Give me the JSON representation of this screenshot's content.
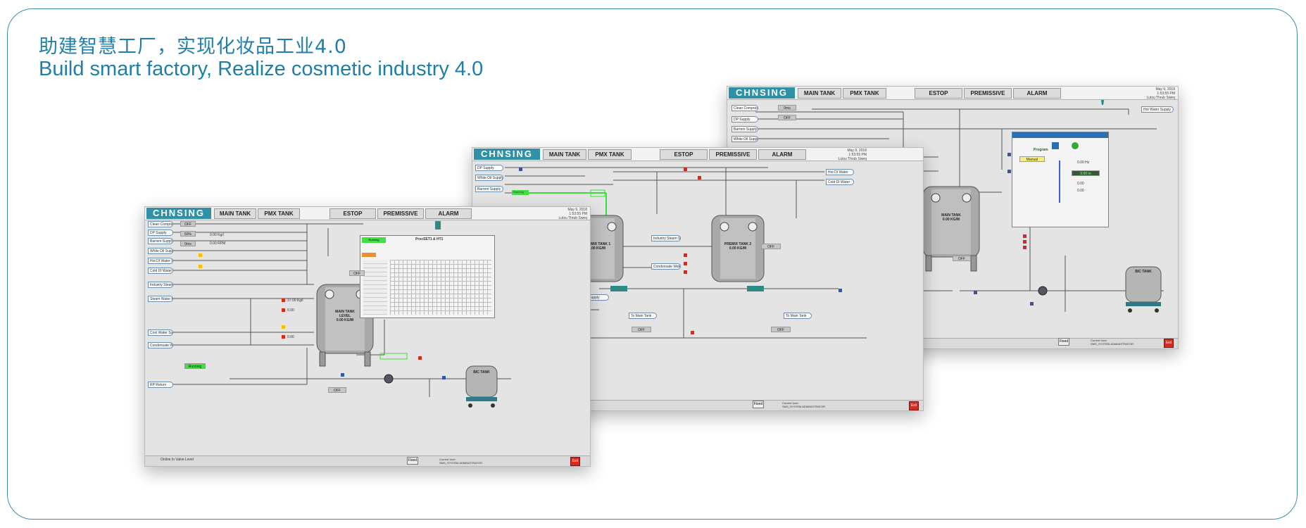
{
  "header": {
    "title_cn": "助建智慧工厂，实现化妆品工业4.0",
    "title_en": "Build smart factory, Realize cosmetic industry 4.0"
  },
  "colors": {
    "accent": "#1f7fa8",
    "logo": "#2f90a6",
    "running": "#44dd44",
    "alarm": "#d62a1e"
  },
  "hmi": {
    "logo": "CHNSING",
    "tabs": [
      "MAIN TANK",
      "PMX TANK",
      "ESTOP",
      "PREMISSIVE",
      "ALARM"
    ],
    "date": [
      "May 9, 2018",
      "1:53:55 PM",
      "Lutzu  Thrub  Sweq"
    ],
    "exit": "Exit",
    "fixed": "Fixed",
    "user": [
      "Current User",
      "SMS_SYSTEM ADMINISTRATOR"
    ]
  },
  "screen1": {
    "supplies": [
      "Clean Compressed Air",
      "DP Supply",
      "Barrem Supply",
      "White Oil Supply",
      "Hot DI Water Supply",
      "Cold DI Water Supply"
    ],
    "supplies2": [
      "Industry Steam Supply",
      "Steam Water Return",
      "Cool Water Supply",
      "Condensate Water Return",
      "RP Return"
    ],
    "tank_main": [
      "MAIN TANK",
      "LEVEL",
      "0.00 KG/M"
    ],
    "tank_bic": "BIC TANK",
    "recipe_title": "ProcSET1 & HT1",
    "recipe_status": "Running",
    "pump_status": "Running",
    "values": [
      "0.00 Kg/l",
      "0.00 RPM",
      "0.00",
      "37.00 Kg/l",
      "0.00",
      "0.00"
    ],
    "vbox": [
      "OFF",
      "50%",
      "0ms",
      "OFF",
      "OFF"
    ],
    "footer": "Online  In  Valve Level"
  },
  "screen2": {
    "supplies": [
      "DP Supply",
      "White Oil Supply",
      "Barrem Supply"
    ],
    "right_supplies": [
      "Hot DI Water",
      "Cold DI Water"
    ],
    "tank1": [
      "PREMIX TANK 1",
      "0.00 KG/M"
    ],
    "tank2": [
      "PREMIX TANK 2",
      "0.00 KG/M"
    ],
    "mid": [
      "Industry Steam Supply",
      "Condensate Water Return",
      "RP Supply",
      "To Main Tank",
      "To Main Tank"
    ],
    "running": "Running"
  },
  "screen3": {
    "supplies": [
      "Clean Compressed Air",
      "DP Supply",
      "Barrem Supply",
      "White Oil Supply"
    ],
    "right": "Hot Water Supply",
    "tank_main": [
      "MAIN TANK",
      "0.00 KG/M"
    ],
    "tank_bic": "BIC TANK",
    "popup": [
      "Program",
      "Manual",
      "0.00 Hz",
      "0.00 m",
      "0.00",
      "0.00"
    ]
  }
}
